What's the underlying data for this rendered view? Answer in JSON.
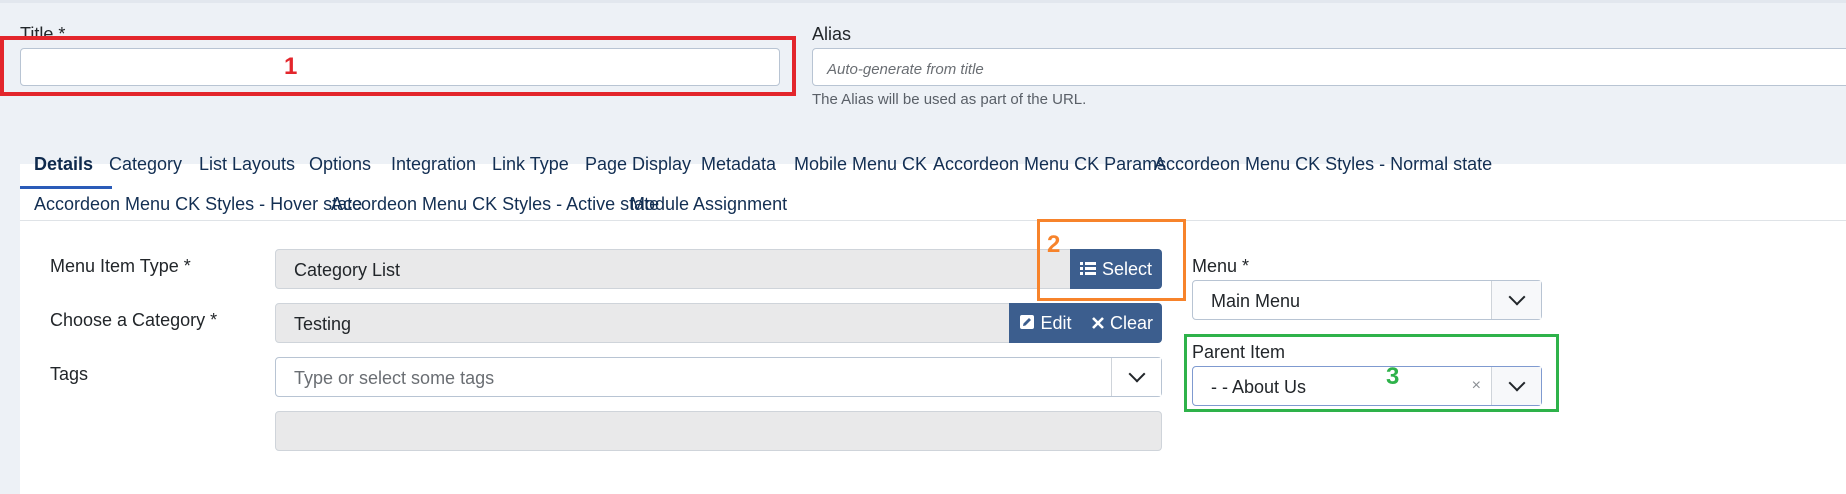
{
  "title_field": {
    "label": "Title *",
    "value": ""
  },
  "alias_field": {
    "label": "Alias",
    "placeholder": "Auto-generate from title",
    "help": "The Alias will be used as part of the URL."
  },
  "tabs": {
    "row1": [
      "Details",
      "Category",
      "List Layouts",
      "Options",
      "Integration",
      "Link Type",
      "Page Display",
      "Metadata",
      "Mobile Menu CK",
      "Accordeon Menu CK Params",
      "Accordeon Menu CK Styles - Normal state"
    ],
    "row2": [
      "Accordeon Menu CK Styles - Hover state",
      "Accordeon Menu CK Styles - Active state",
      "Module Assignment"
    ],
    "active": "Details"
  },
  "details": {
    "menu_item_type": {
      "label": "Menu Item Type *",
      "value": "Category List",
      "select_label": "Select"
    },
    "category": {
      "label": "Choose a Category *",
      "value": "Testing",
      "edit_label": "Edit",
      "clear_label": "Clear"
    },
    "tags": {
      "label": "Tags",
      "placeholder": "Type or select some tags"
    }
  },
  "sidebar": {
    "menu": {
      "label": "Menu *",
      "value": "Main Menu"
    },
    "parent_item": {
      "label": "Parent Item",
      "value": "- - About Us",
      "clear_glyph": "×"
    }
  },
  "annotations": [
    {
      "number": "1",
      "color": "#e3262c"
    },
    {
      "number": "2",
      "color": "#f7832b"
    },
    {
      "number": "3",
      "color": "#2eb24a"
    }
  ]
}
